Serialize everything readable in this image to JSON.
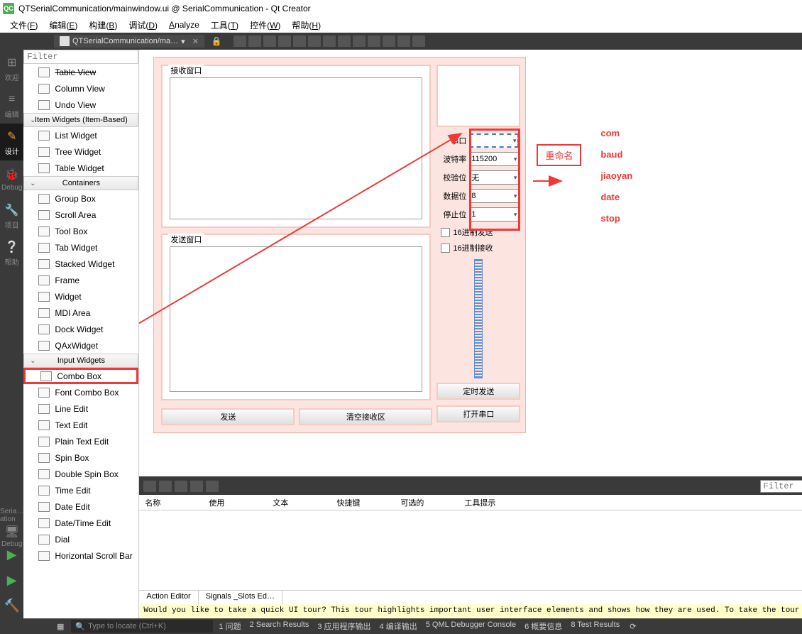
{
  "window": {
    "title": "QTSerialCommunication/mainwindow.ui @ SerialCommunication - Qt Creator",
    "app_badge": "QC"
  },
  "menubar": [
    {
      "label": "文件",
      "key": "F"
    },
    {
      "label": "编辑",
      "key": "E"
    },
    {
      "label": "构建",
      "key": "B"
    },
    {
      "label": "调试",
      "key": "D"
    },
    {
      "label": "Analyze",
      "key": ""
    },
    {
      "label": "工具",
      "key": "T"
    },
    {
      "label": "控件",
      "key": "W"
    },
    {
      "label": "帮助",
      "key": "H"
    }
  ],
  "file_tab": "QTSerialCommunication/ma…",
  "left_nav": [
    {
      "icon": "⊞",
      "label": "欢迎"
    },
    {
      "icon": "≡",
      "label": "编辑"
    },
    {
      "icon": "✎",
      "label": "设计",
      "active": true
    },
    {
      "icon": "🐞",
      "label": "Debug"
    },
    {
      "icon": "🔧",
      "label": "项目"
    },
    {
      "icon": "❔",
      "label": "帮助"
    }
  ],
  "left_nav_bottom_label1": "Seria…ation",
  "left_nav_bottom_label2": "Debug",
  "filter_placeholder": "Filter",
  "widget_tree": [
    {
      "type": "item",
      "label": "Table View",
      "strike": true
    },
    {
      "type": "item",
      "label": "Column View"
    },
    {
      "type": "item",
      "label": "Undo View"
    },
    {
      "type": "category",
      "label": "Item Widgets (Item-Based)"
    },
    {
      "type": "item",
      "label": "List Widget"
    },
    {
      "type": "item",
      "label": "Tree Widget"
    },
    {
      "type": "item",
      "label": "Table Widget"
    },
    {
      "type": "category",
      "label": "Containers"
    },
    {
      "type": "item",
      "label": "Group Box"
    },
    {
      "type": "item",
      "label": "Scroll Area"
    },
    {
      "type": "item",
      "label": "Tool Box"
    },
    {
      "type": "item",
      "label": "Tab Widget"
    },
    {
      "type": "item",
      "label": "Stacked Widget"
    },
    {
      "type": "item",
      "label": "Frame"
    },
    {
      "type": "item",
      "label": "Widget"
    },
    {
      "type": "item",
      "label": "MDI Area"
    },
    {
      "type": "item",
      "label": "Dock Widget"
    },
    {
      "type": "item",
      "label": "QAxWidget"
    },
    {
      "type": "category",
      "label": "Input Widgets"
    },
    {
      "type": "item",
      "label": "Combo Box",
      "highlighted": true
    },
    {
      "type": "item",
      "label": "Font Combo Box"
    },
    {
      "type": "item",
      "label": "Line Edit"
    },
    {
      "type": "item",
      "label": "Text Edit"
    },
    {
      "type": "item",
      "label": "Plain Text Edit"
    },
    {
      "type": "item",
      "label": "Spin Box"
    },
    {
      "type": "item",
      "label": "Double Spin Box"
    },
    {
      "type": "item",
      "label": "Time Edit"
    },
    {
      "type": "item",
      "label": "Date Edit"
    },
    {
      "type": "item",
      "label": "Date/Time Edit"
    },
    {
      "type": "item",
      "label": "Dial"
    },
    {
      "type": "item",
      "label": "Horizontal Scroll Bar"
    }
  ],
  "form": {
    "recv_title": "接收窗口",
    "send_title": "发送窗口",
    "fields": [
      {
        "label": "串口",
        "value": "",
        "selected": true
      },
      {
        "label": "波特率",
        "value": "115200"
      },
      {
        "label": "校验位",
        "value": "无"
      },
      {
        "label": "数据位",
        "value": "8"
      },
      {
        "label": "停止位",
        "value": "1"
      }
    ],
    "chk_send_hex": "16进制发送",
    "chk_recv_hex": "16进制接收",
    "btn_timed": "定时发送",
    "btn_open": "打开串口",
    "btn_send": "发送",
    "btn_clear": "清空接收区"
  },
  "annotations": {
    "rename": "重命名",
    "list": [
      "com",
      "baud",
      "jiaoyan",
      "date",
      "stop"
    ]
  },
  "bottom_panel": {
    "columns": [
      "名称",
      "使用",
      "文本",
      "快捷键",
      "可选的",
      "工具提示"
    ],
    "tabs": [
      "Action Editor",
      "Signals _Slots Ed…"
    ],
    "filter": "Filter"
  },
  "tour_msg": "Would you like to take a quick UI tour? This tour highlights important user interface elements and shows how they are used. To take the tour later, select Help > UI Tour.",
  "status": {
    "locator": "Type to locate (Ctrl+K)",
    "items": [
      "1  问题",
      "2  Search Results",
      "3  应用程序输出",
      "4  编译输出",
      "5  QML Debugger Console",
      "6  概要信息",
      "8  Test Results"
    ]
  }
}
